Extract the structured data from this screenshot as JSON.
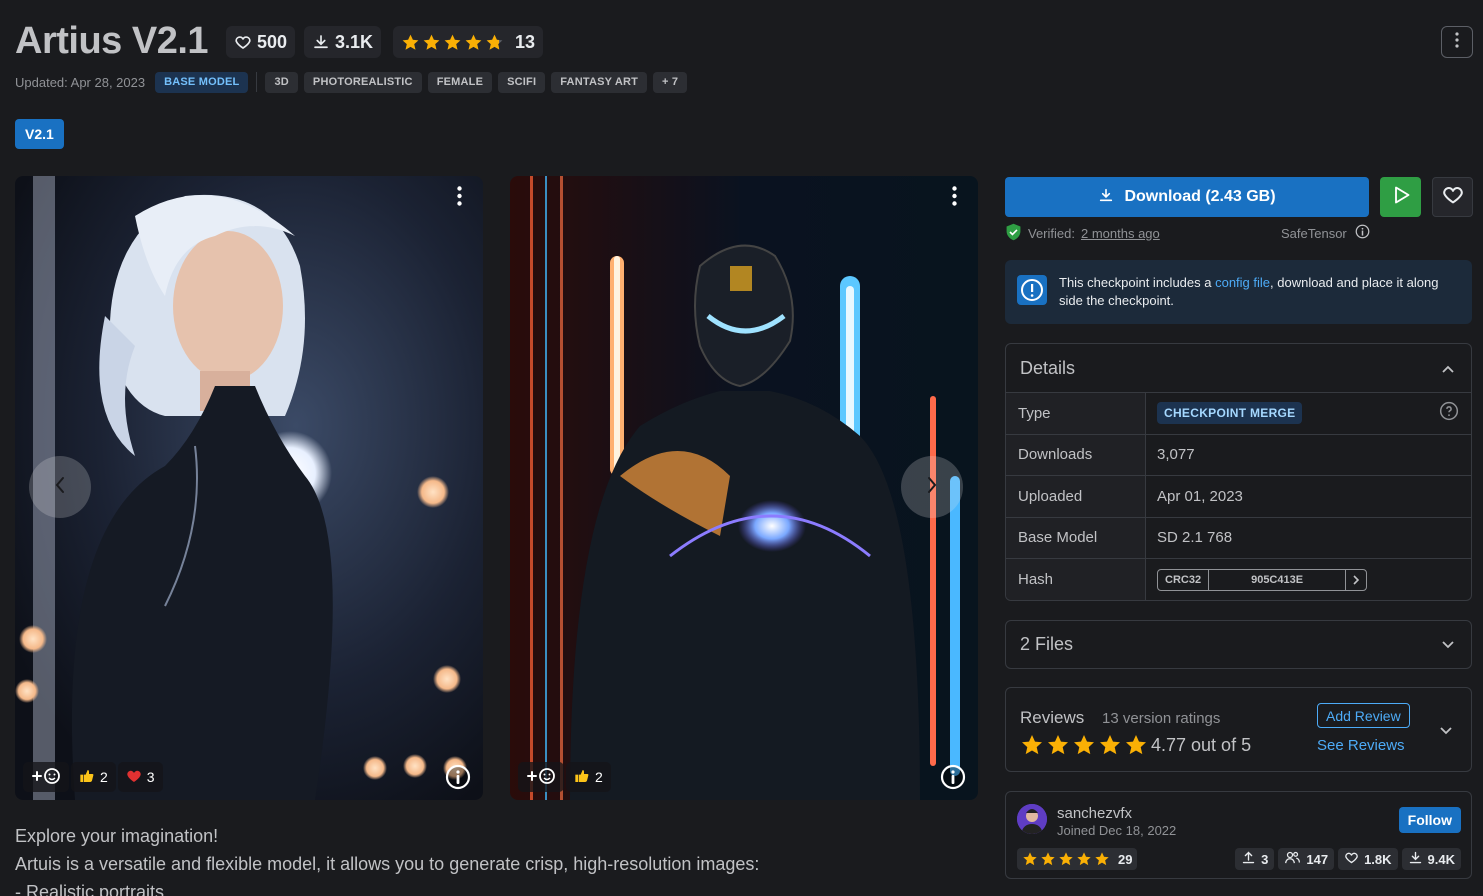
{
  "model": {
    "title": "Artius V2.1",
    "favorites": "500",
    "downloads": "3.1K",
    "rating_count": "13",
    "updated": "Updated: Apr 28, 2023",
    "tags": [
      "BASE MODEL",
      "3D",
      "PHOTOREALISTIC",
      "FEMALE",
      "SCIFI",
      "FANTASY ART",
      "+ 7"
    ],
    "version": "V2.1"
  },
  "images": [
    {
      "reactions": [
        {
          "icon": "add-reaction-icon",
          "count": ""
        },
        {
          "icon": "thumbs-up-icon",
          "count": "2"
        },
        {
          "icon": "heart-icon",
          "count": "3"
        }
      ]
    },
    {
      "reactions": [
        {
          "icon": "add-reaction-icon",
          "count": ""
        },
        {
          "icon": "thumbs-up-icon",
          "count": "2"
        }
      ]
    }
  ],
  "description": {
    "line1": "Explore your imagination!",
    "line2": "Artuis is a versatile and flexible model, it allows you to generate crisp, high-resolution images:",
    "line3": "- Realistic portraits"
  },
  "download": {
    "label": "Download (2.43 GB)",
    "verified_label": "Verified:",
    "verified_time": "2 months ago",
    "format": "SafeTensor"
  },
  "alert": {
    "text_before": "This checkpoint includes a ",
    "link": "config file",
    "text_after": ", download and place it along side the checkpoint."
  },
  "details": {
    "title": "Details",
    "rows": [
      {
        "label": "Type",
        "value": "CHECKPOINT MERGE"
      },
      {
        "label": "Downloads",
        "value": "3,077"
      },
      {
        "label": "Uploaded",
        "value": "Apr 01, 2023"
      },
      {
        "label": "Base Model",
        "value": "SD 2.1 768"
      },
      {
        "label": "Hash",
        "hash_type": "CRC32",
        "hash_value": "905C413E"
      }
    ]
  },
  "files": {
    "title": "2 Files"
  },
  "reviews": {
    "title": "Reviews",
    "count": "13 version ratings",
    "score": "4.77 out of 5",
    "add": "Add Review",
    "see": "See Reviews",
    "stars": 4.77
  },
  "creator": {
    "name": "sanchezvfx",
    "joined": "Joined Dec 18, 2022",
    "follow": "Follow",
    "rating_count": "29",
    "uploads": "3",
    "followers": "147",
    "favorites": "1.8K",
    "downloads": "9.4K"
  },
  "colors": {
    "accent": "#1971c2",
    "star": "#fab005",
    "background": "#1a1b1e",
    "play": "#2f9e44"
  }
}
